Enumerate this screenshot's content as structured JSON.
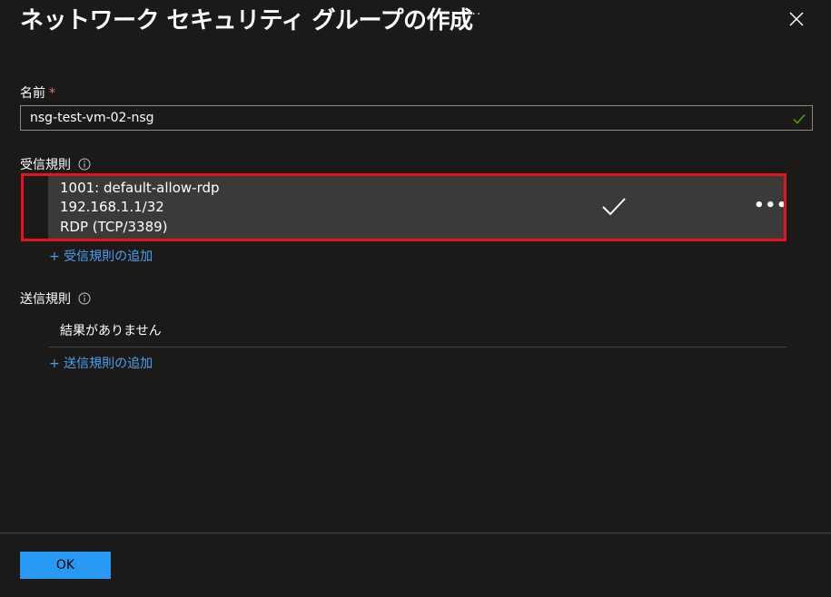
{
  "header": {
    "title": "ネットワーク セキュリティ グループの作成",
    "more_label": "···",
    "close_icon": "close-icon"
  },
  "name_field": {
    "label": "名前",
    "required_marker": "*",
    "value": "nsg-test-vm-02-nsg",
    "valid_icon": "check-icon"
  },
  "inbound": {
    "label": "受信規則",
    "info_icon": "info-icon",
    "rules": [
      {
        "title": "1001: default-allow-rdp",
        "source": "192.168.1.1/32",
        "service": "RDP (TCP/3389)",
        "status_icon": "check-icon",
        "more_label": "•••"
      }
    ],
    "add_link": "+ 受信規則の追加"
  },
  "outbound": {
    "label": "送信規則",
    "info_icon": "info-icon",
    "empty_text": "結果がありません",
    "add_link": "+ 送信規則の追加"
  },
  "footer": {
    "ok_label": "OK"
  },
  "colors": {
    "background": "#1b1a19",
    "highlight": "#e81123",
    "link": "#4aa0f0",
    "primary_button": "#2899f5",
    "valid_check": "#57a300"
  }
}
